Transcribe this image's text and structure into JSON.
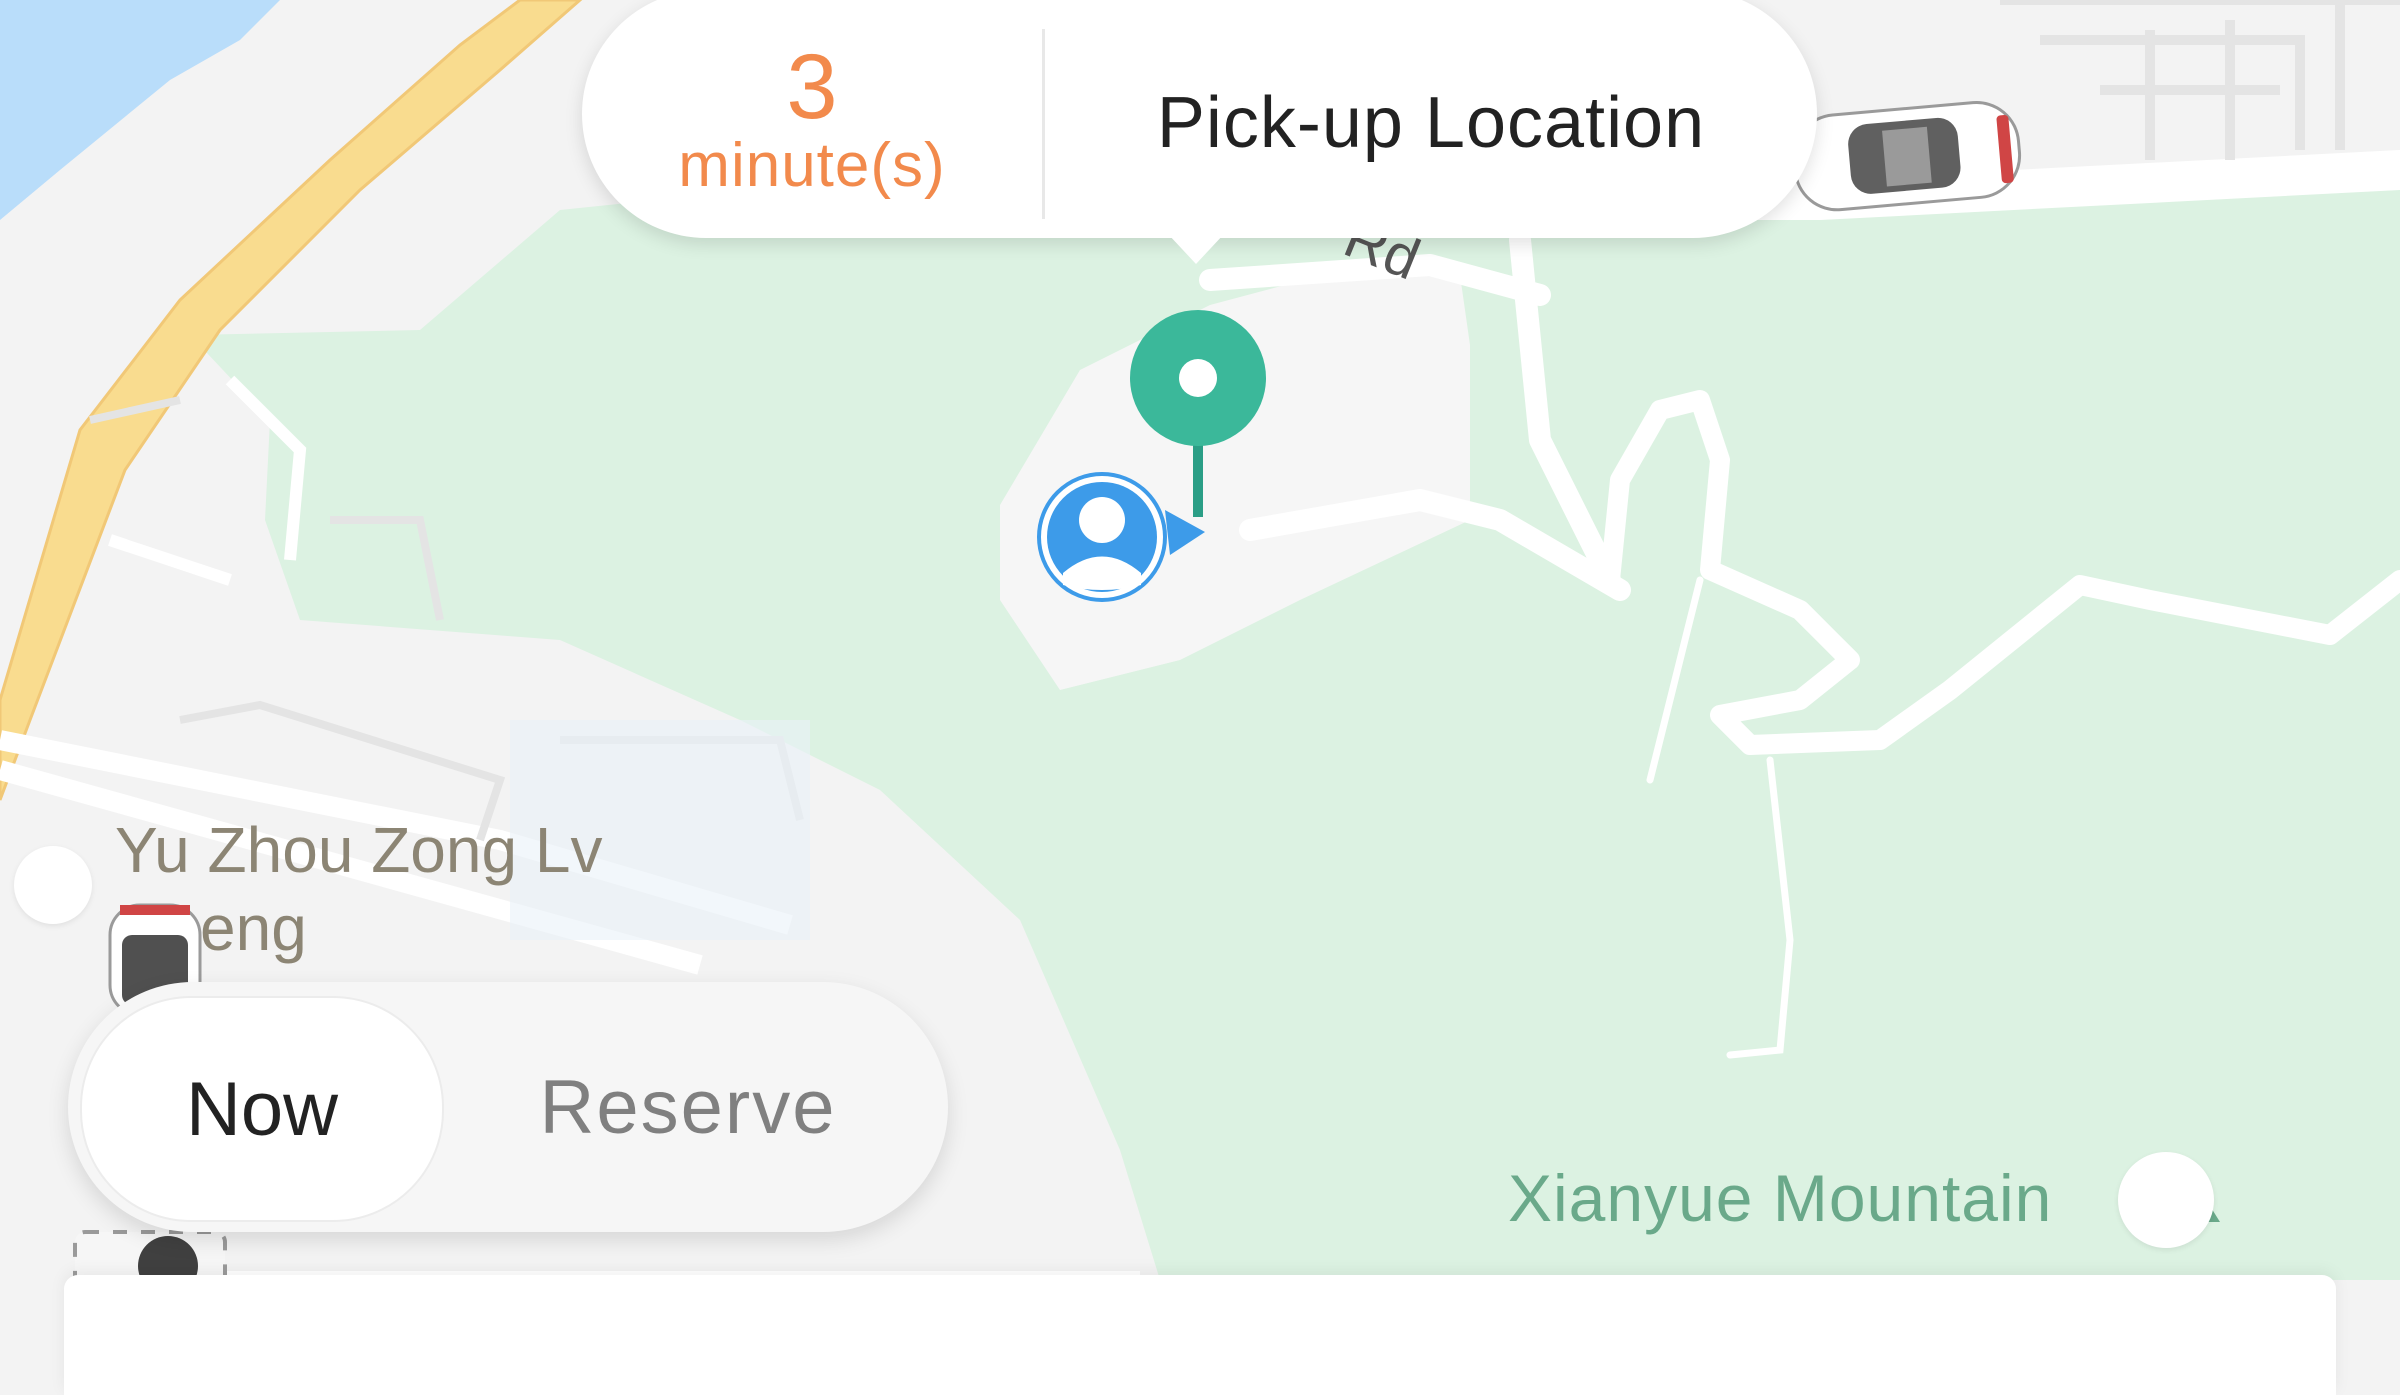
{
  "eta": {
    "value": "3",
    "unit": "minute(s)"
  },
  "pickup": {
    "label": "Pick-up Location"
  },
  "mode_toggle": {
    "now_label": "Now",
    "reserve_label": "Reserve",
    "selected": "Now"
  },
  "map": {
    "poi_line1": "Yu Zhou Zong Lv",
    "poi_line2": "eng",
    "road_fragment": "Rd",
    "mountain": "Xianyue Mountain"
  },
  "colors": {
    "eta": "#f28a4c",
    "park": "#dcf2e2",
    "pin": "#3bb89a",
    "user_marker": "#3d9be9",
    "highway": "#f9dc8f",
    "water": "#b9ddfa"
  }
}
